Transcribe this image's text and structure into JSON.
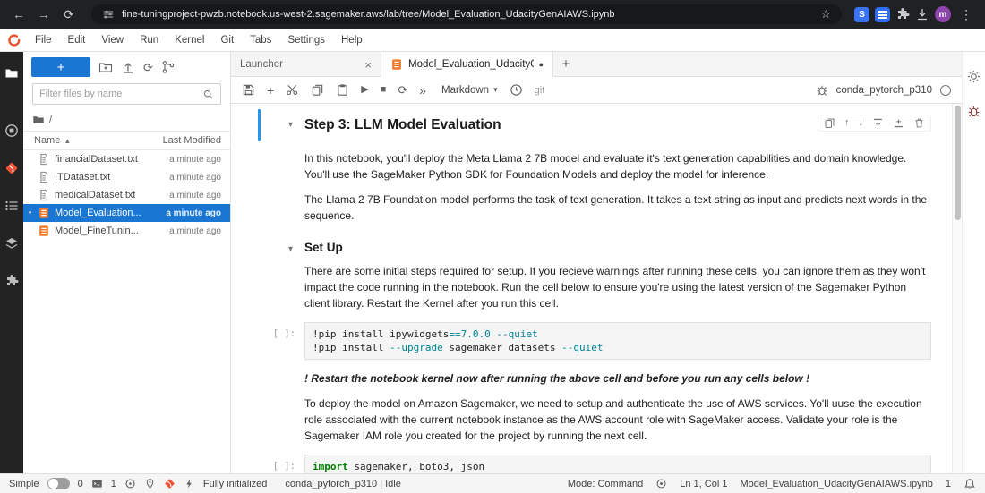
{
  "icons": {
    "back": "←",
    "forward": "→",
    "reload": "⟳",
    "star": "☆",
    "menu_dots": "⋮",
    "plus": "+",
    "cut_hint": "✂",
    "run": "▶",
    "stop": "■",
    "restart": "⟳",
    "fast_forward": "»",
    "caret_down": "▾",
    "collapse": "▾",
    "sort_up": "▲",
    "close": "×",
    "arrow_up": "↑",
    "arrow_down": "↓",
    "dirty_dot": "●",
    "bullet": "●"
  },
  "browser": {
    "url": "fine-tuningproject-pwzb.notebook.us-west-2.sagemaker.aws/lab/tree/Model_Evaluation_UdacityGenAIAWS.ipynb",
    "avatar": "m",
    "ext_s": "S"
  },
  "menubar": {
    "items": [
      "File",
      "Edit",
      "View",
      "Run",
      "Kernel",
      "Git",
      "Tabs",
      "Settings",
      "Help"
    ]
  },
  "filebrowser": {
    "filter_placeholder": "Filter files by name",
    "breadcrumb_root": "/",
    "col_name": "Name",
    "col_modified": "Last Modified",
    "files": [
      {
        "name": "financialDataset.txt",
        "modified": "a minute ago"
      },
      {
        "name": "ITDataset.txt",
        "modified": "a minute ago"
      },
      {
        "name": "medicalDataset.txt",
        "modified": "a minute ago"
      },
      {
        "name": "Model_Evaluation...",
        "modified": "a minute ago"
      },
      {
        "name": "Model_FineTunin...",
        "modified": "a minute ago"
      }
    ]
  },
  "tabbar": {
    "launcher": "Launcher",
    "active_tab": "Model_Evaluation_UdacityGe"
  },
  "nbtoolbar": {
    "cell_type": "Markdown",
    "git": "git",
    "kernel": "conda_pytorch_p310"
  },
  "cells": {
    "h1": "Step 3: LLM Model Evaluation",
    "p1": "In this notebook, you'll deploy the Meta Llama 2 7B model and evaluate it's text generation capabilities and domain knowledge. You'll use the SageMaker Python SDK for Foundation Models and deploy the model for inference.",
    "p2": "The Llama 2 7B Foundation model performs the task of text generation. It takes a text string as input and predicts next words in the sequence.",
    "h2": "Set Up",
    "p3": "There are some initial steps required for setup. If you recieve warnings after running these cells, you can ignore them as they won't impact the code running in the notebook. Run the cell below to ensure you're using the latest version of the Sagemaker Python client library. Restart the Kernel after you run this cell.",
    "prompt_empty": "[ ]:",
    "code1": {
      "a": "!pip install ipywidgets",
      "b": "==",
      "c": "7.0.0",
      "d": " --quiet",
      "e": "!pip install ",
      "f": "--upgrade",
      "g": " sagemaker datasets ",
      "h": "--quiet"
    },
    "note": "! Restart the notebook kernel now after running the above cell and before you run any cells below !",
    "p4": "To deploy the model on Amazon Sagemaker, we need to setup and authenticate the use of AWS services. Yo'll uuse the execution role associated with the current notebook instance as the AWS account role with SageMaker access. Validate your role is the Sagemaker IAM role you created for the project by running the next cell.",
    "code2": {
      "kw": "import",
      "rest": " sagemaker, boto3, json"
    }
  },
  "statusbar": {
    "simple": "Simple",
    "terminals": "0",
    "kernels": "1",
    "init": "Fully initialized",
    "kernel_status": "conda_pytorch_p310 | Idle",
    "mode": "Mode: Command",
    "position": "Ln 1, Col 1",
    "filename": "Model_Evaluation_UdacityGenAIAWS.ipynb",
    "notif_count": "1"
  }
}
